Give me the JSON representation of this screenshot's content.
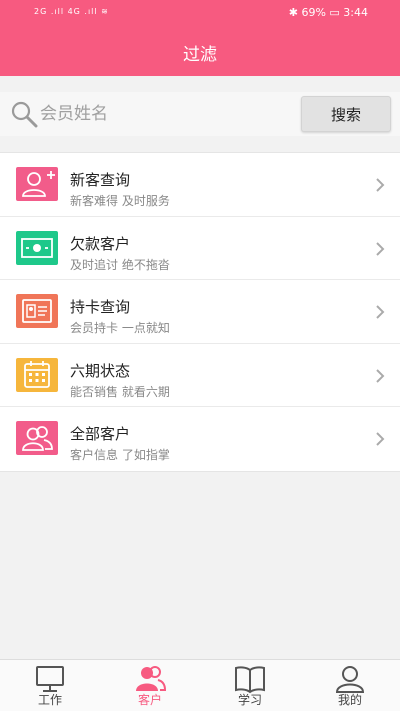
{
  "status_bar": {
    "left": "2G  .ıll  4G  .ıll  ≋",
    "right": "✱ 69% ▭ 3:44"
  },
  "header": {
    "title": "过滤"
  },
  "search": {
    "placeholder": "会员姓名",
    "button_label": "搜索"
  },
  "menu": [
    {
      "title": "新客查询",
      "subtitle": "新客难得 及时服务",
      "icon": "add-user-icon",
      "color": "#f25c8a"
    },
    {
      "title": "欠款客户",
      "subtitle": "及时追讨 绝不拖沓",
      "icon": "money-icon",
      "color": "#1ec88a"
    },
    {
      "title": "持卡查询",
      "subtitle": "会员持卡 一点就知",
      "icon": "card-icon",
      "color": "#f07558"
    },
    {
      "title": "六期状态",
      "subtitle": "能否销售 就看六期",
      "icon": "calendar-icon",
      "color": "#f6b63c"
    },
    {
      "title": "全部客户",
      "subtitle": "客户信息 了如指掌",
      "icon": "users-icon",
      "color": "#f25c8a"
    }
  ],
  "tabs": [
    {
      "label": "工作",
      "icon": "monitor-icon"
    },
    {
      "label": "客户",
      "icon": "customers-icon",
      "active": true
    },
    {
      "label": "学习",
      "icon": "book-icon"
    },
    {
      "label": "我的",
      "icon": "profile-icon"
    }
  ],
  "colors": {
    "brand": "#f75a80"
  }
}
